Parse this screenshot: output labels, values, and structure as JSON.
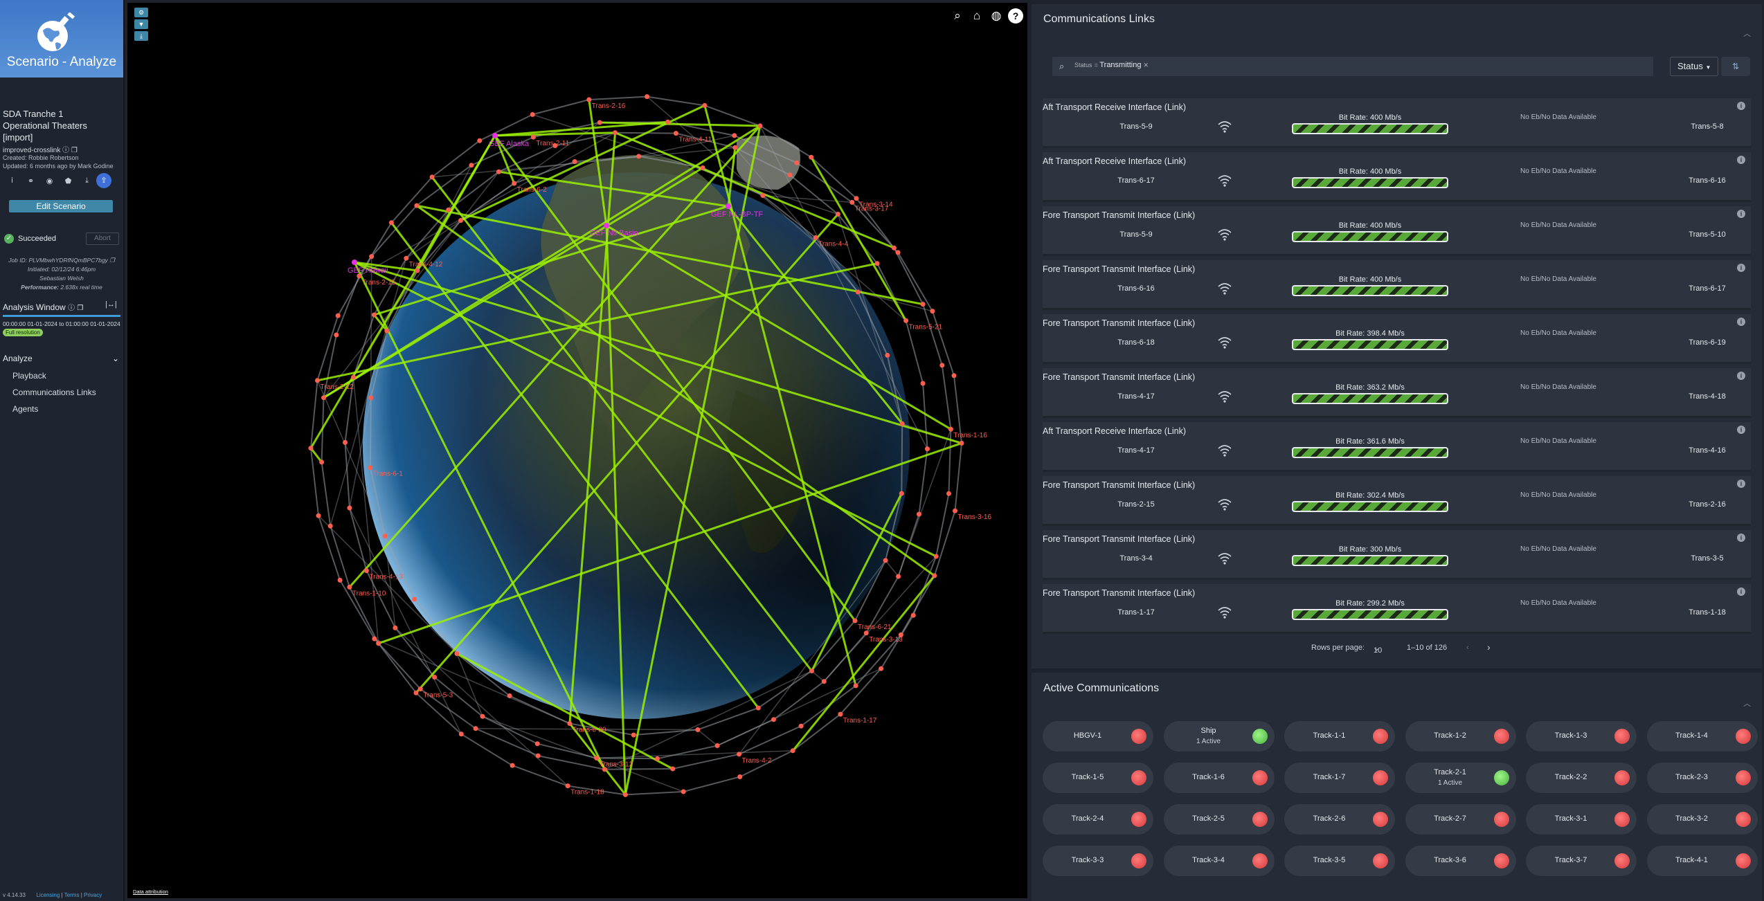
{
  "sidebar": {
    "app_title": "Scenario - Analyze",
    "scenario_name": "SDA Tranche 1 Operational Theaters [import]",
    "scenario_name_lines": [
      "SDA Tranche 1",
      "Operational Theaters",
      "[import]"
    ],
    "branch": "improved-crosslink",
    "created": "Created: Robbie Robertson",
    "updated": "Updated: 6 months ago by Mark Godine",
    "edit_button": "Edit Scenario",
    "status": "Succeeded",
    "abort": "Abort",
    "job_id": "Job ID: PLVMbwhYDRfNQmBPC7bgy",
    "initiated": "Initiated: 02/12/24 6:46pm",
    "initiator": "Sebastian Welsh",
    "performance_label": "Performance:",
    "performance_value": "2.638x real time",
    "analysis_window_title": "Analysis Window",
    "analysis_range": "00:00:00 01-01-2024 to 01:00:00 01-01-2024",
    "resolution_badge": "Full resolution",
    "analyze_header": "Analyze",
    "nav_items": [
      "Playback",
      "Communications Links",
      "Agents"
    ],
    "version": "v 4.14.33",
    "footer_links": [
      "Licensing",
      "Terms",
      "Privacy"
    ]
  },
  "globe": {
    "attribution": "Data attribution",
    "ground_stations": [
      "GEF Alaska",
      "GEF Hawaii",
      "GEF Ntl Basin",
      "GEF NL-BP-TF"
    ],
    "satellite_labels": [
      "Trans-1-16",
      "Trans-1-17",
      "Trans-1-18",
      "Trans-1-10",
      "Trans-2-15",
      "Trans-2-16",
      "Trans-3-14",
      "Trans-3-13",
      "Trans-3-12",
      "Trans-4-13",
      "Trans-4-12",
      "Trans-4-11",
      "Trans-5-21",
      "Trans-6-21",
      "Trans-6-20",
      "Trans-6-1",
      "Trans-6-2",
      "Trans-4-4",
      "Trans-4-2",
      "Trans-5-3",
      "Trans-2-12",
      "Trans-2-11",
      "Trans-3-17",
      "Trans-3-16",
      "Trans-3-15"
    ],
    "view_icons": [
      "search-icon",
      "home-icon",
      "globe-icon",
      "help-icon"
    ]
  },
  "comm_links": {
    "title": "Communications Links",
    "filter_key": "Status",
    "filter_value": "Transmitting",
    "status_dropdown": "Status",
    "links": [
      {
        "title": "Aft Transport Receive Interface (Link)",
        "src": "Trans-5-9",
        "rate": "Bit Rate: 400 Mb/s",
        "nodata": "No Eb/No Data Available",
        "dst": "Trans-5-8"
      },
      {
        "title": "Aft Transport Receive Interface (Link)",
        "src": "Trans-6-17",
        "rate": "Bit Rate: 400 Mb/s",
        "nodata": "No Eb/No Data Available",
        "dst": "Trans-6-16"
      },
      {
        "title": "Fore Transport Transmit Interface (Link)",
        "src": "Trans-5-9",
        "rate": "Bit Rate: 400 Mb/s",
        "nodata": "No Eb/No Data Available",
        "dst": "Trans-5-10"
      },
      {
        "title": "Fore Transport Transmit Interface (Link)",
        "src": "Trans-6-16",
        "rate": "Bit Rate: 400 Mb/s",
        "nodata": "No Eb/No Data Available",
        "dst": "Trans-6-17"
      },
      {
        "title": "Fore Transport Transmit Interface (Link)",
        "src": "Trans-6-18",
        "rate": "Bit Rate: 398.4 Mb/s",
        "nodata": "No Eb/No Data Available",
        "dst": "Trans-6-19"
      },
      {
        "title": "Fore Transport Transmit Interface (Link)",
        "src": "Trans-4-17",
        "rate": "Bit Rate: 363.2 Mb/s",
        "nodata": "No Eb/No Data Available",
        "dst": "Trans-4-18"
      },
      {
        "title": "Aft Transport Receive Interface (Link)",
        "src": "Trans-4-17",
        "rate": "Bit Rate: 361.6 Mb/s",
        "nodata": "No Eb/No Data Available",
        "dst": "Trans-4-16"
      },
      {
        "title": "Fore Transport Transmit Interface (Link)",
        "src": "Trans-2-15",
        "rate": "Bit Rate: 302.4 Mb/s",
        "nodata": "No Eb/No Data Available",
        "dst": "Trans-2-16"
      },
      {
        "title": "Fore Transport Transmit Interface (Link)",
        "src": "Trans-3-4",
        "rate": "Bit Rate: 300 Mb/s",
        "nodata": "No Eb/No Data Available",
        "dst": "Trans-3-5"
      },
      {
        "title": "Fore Transport Transmit Interface (Link)",
        "src": "Trans-1-17",
        "rate": "Bit Rate: 299.2 Mb/s",
        "nodata": "No Eb/No Data Available",
        "dst": "Trans-1-18"
      }
    ],
    "rows_per_page_label": "Rows per page:",
    "rows_per_page": "10",
    "range": "1–10 of 126"
  },
  "active_comms": {
    "title": "Active Communications",
    "agents": [
      {
        "name": "HBGV-1",
        "sub": "",
        "status": "red"
      },
      {
        "name": "Ship",
        "sub": "1 Active",
        "status": "green"
      },
      {
        "name": "Track-1-1",
        "sub": "",
        "status": "red"
      },
      {
        "name": "Track-1-2",
        "sub": "",
        "status": "red"
      },
      {
        "name": "Track-1-3",
        "sub": "",
        "status": "red"
      },
      {
        "name": "Track-1-4",
        "sub": "",
        "status": "red"
      },
      {
        "name": "Track-1-5",
        "sub": "",
        "status": "red"
      },
      {
        "name": "Track-1-6",
        "sub": "",
        "status": "red"
      },
      {
        "name": "Track-1-7",
        "sub": "",
        "status": "red"
      },
      {
        "name": "Track-2-1",
        "sub": "1 Active",
        "status": "green"
      },
      {
        "name": "Track-2-2",
        "sub": "",
        "status": "red"
      },
      {
        "name": "Track-2-3",
        "sub": "",
        "status": "red"
      },
      {
        "name": "Track-2-4",
        "sub": "",
        "status": "red"
      },
      {
        "name": "Track-2-5",
        "sub": "",
        "status": "red"
      },
      {
        "name": "Track-2-6",
        "sub": "",
        "status": "red"
      },
      {
        "name": "Track-2-7",
        "sub": "",
        "status": "red"
      },
      {
        "name": "Track-3-1",
        "sub": "",
        "status": "red"
      },
      {
        "name": "Track-3-2",
        "sub": "",
        "status": "red"
      },
      {
        "name": "Track-3-3",
        "sub": "",
        "status": "red"
      },
      {
        "name": "Track-3-4",
        "sub": "",
        "status": "red"
      },
      {
        "name": "Track-3-5",
        "sub": "",
        "status": "red"
      },
      {
        "name": "Track-3-6",
        "sub": "",
        "status": "red"
      },
      {
        "name": "Track-3-7",
        "sub": "",
        "status": "red"
      },
      {
        "name": "Track-4-1",
        "sub": "",
        "status": "red"
      }
    ]
  },
  "colors": {
    "accent": "#3f87a6",
    "link_green": "#9bf000",
    "sat_red": "#ff5f4f",
    "gs_magenta": "#e633e6"
  }
}
